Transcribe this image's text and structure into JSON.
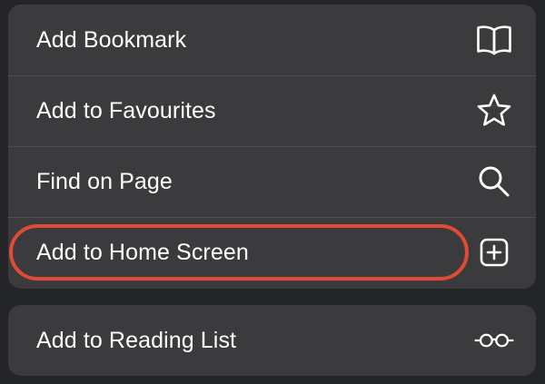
{
  "menu": {
    "items": [
      {
        "label": "Add Bookmark",
        "icon": "book-icon"
      },
      {
        "label": "Add to Favourites",
        "icon": "star-icon"
      },
      {
        "label": "Find on Page",
        "icon": "magnifying-glass-icon"
      },
      {
        "label": "Add to Home Screen",
        "icon": "plus-square-icon",
        "highlighted": true
      }
    ],
    "secondary_items": [
      {
        "label": "Add to Reading List",
        "icon": "glasses-icon"
      }
    ]
  },
  "colors": {
    "background": "#242526",
    "group_background": "#3b3b3d",
    "separator": "#4e4e51",
    "text": "#ffffff",
    "highlight_ring": "#e14a34"
  }
}
